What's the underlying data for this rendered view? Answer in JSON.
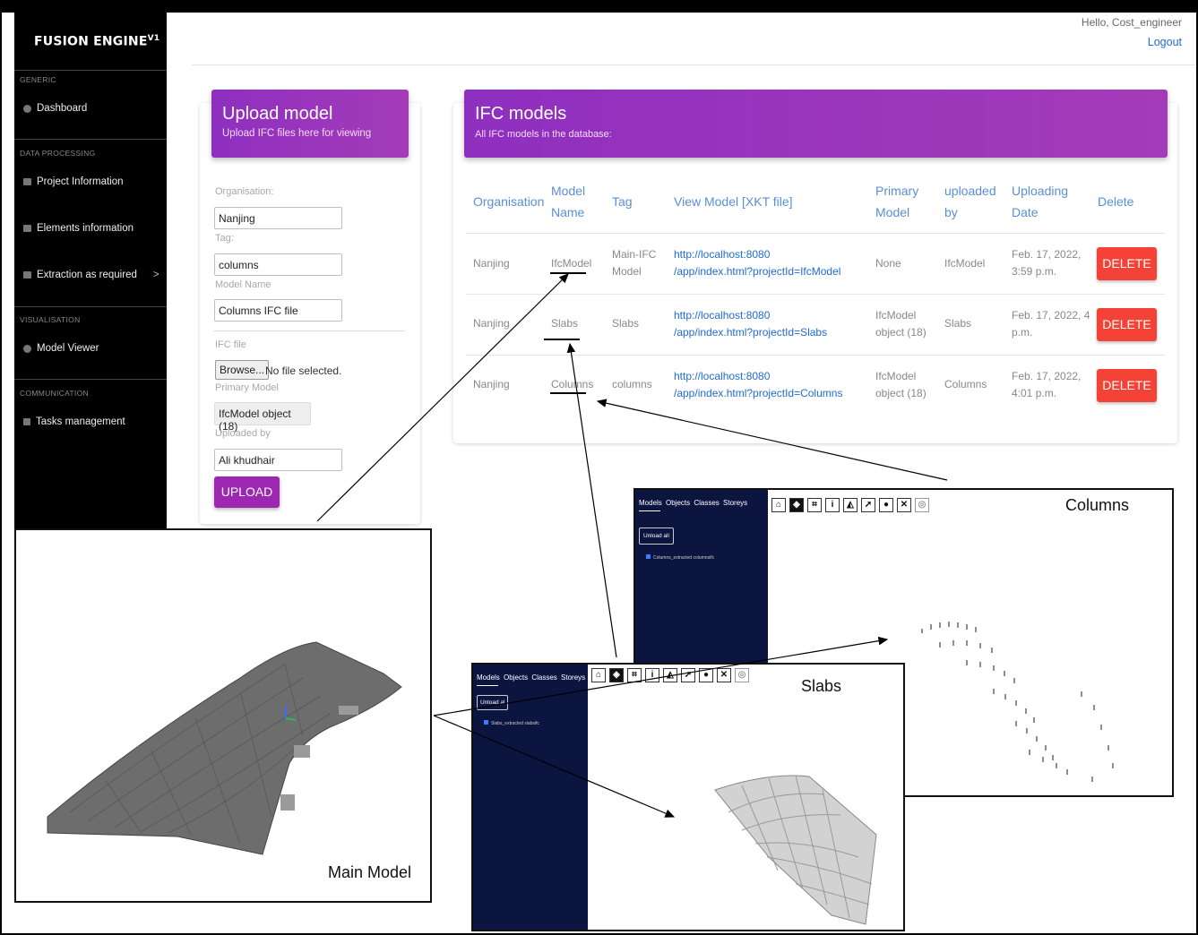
{
  "app": {
    "brand": "FUSION ENGINE",
    "version": "V1"
  },
  "sidebar": {
    "sections": [
      "GENERIC",
      "DATA PROCESSING",
      "VISUALISATION",
      "COMMUNICATION"
    ],
    "items": [
      "Dashboard",
      "Project Information",
      "Elements information",
      "Extraction as required",
      "Model Viewer",
      "Tasks management"
    ]
  },
  "header": {
    "greeting": "Hello, Cost_engineer",
    "logout": "Logout"
  },
  "upload": {
    "title": "Upload model",
    "subtitle": "Upload IFC files here for viewing",
    "organisation_label": "Organisation:",
    "organisation_value": "Nanjing",
    "tag_label": "Tag:",
    "tag_value": "columns",
    "model_name_label": "Model Name",
    "model_name_value": "Columns IFC file",
    "ifc_file_label": "IFC file",
    "browse_label": "Browse...",
    "file_status": "No file selected.",
    "primary_model_label": "Primary Model",
    "primary_model_value": "IfcModel object (18)",
    "uploaded_by_label": "Uploaded by",
    "uploaded_by_value": "Ali khudhair",
    "button_label": "UPLOAD"
  },
  "ifc": {
    "title": "IFC models",
    "subtitle": "All IFC models in the database:",
    "headers": [
      "Organisation",
      [
        "Model",
        "Name"
      ],
      "Tag",
      "View Model [XKT file]",
      [
        "Primary",
        "Model"
      ],
      [
        "uploaded",
        "by"
      ],
      [
        "Uploading",
        "Date"
      ],
      "Delete"
    ],
    "delete_label": "DELETE",
    "rows": [
      {
        "organisation": "Nanjing",
        "model_name": "IfcModel",
        "tag": [
          "Main-IFC",
          "Model"
        ],
        "link": [
          "http://localhost:8080",
          "/app/index.html?projectId=IfcModel"
        ],
        "primary": "None",
        "uploaded_by": "IfcModel",
        "date": [
          "Feb. 17, 2022,",
          "3:59 p.m."
        ]
      },
      {
        "organisation": "Nanjing",
        "model_name": "Slabs",
        "tag": "Slabs",
        "link": [
          "http://localhost:8080",
          "/app/index.html?projectId=Slabs"
        ],
        "primary": [
          "IfcModel",
          "object (18)"
        ],
        "uploaded_by": "Slabs",
        "date": [
          "Feb. 17, 2022, 4",
          "p.m."
        ]
      },
      {
        "organisation": "Nanjing",
        "model_name": "Columns",
        "tag": "columns",
        "link": [
          "http://localhost:8080",
          "/app/index.html?projectId=Columns"
        ],
        "primary": [
          "IfcModel",
          "object (18)"
        ],
        "uploaded_by": "Columns",
        "date": [
          "Feb. 17, 2022,",
          "4:01 p.m."
        ]
      }
    ]
  },
  "viewer": {
    "tabs": "Models Objects Classes Storeys",
    "unload_all": "Unload all",
    "unload_all_short": "Unload al",
    "columns_item": "Columns_extracted columnsifc",
    "slabs_item": "Slabs_extracted slabsifc",
    "columns_title": "Columns",
    "slabs_title": "Slabs",
    "main_title": "Main Model"
  },
  "colors": {
    "accent": "#9c27b0",
    "delete": "#f44336",
    "link": "#1f6bd6",
    "viewer_sidebar": "#0c1540"
  }
}
